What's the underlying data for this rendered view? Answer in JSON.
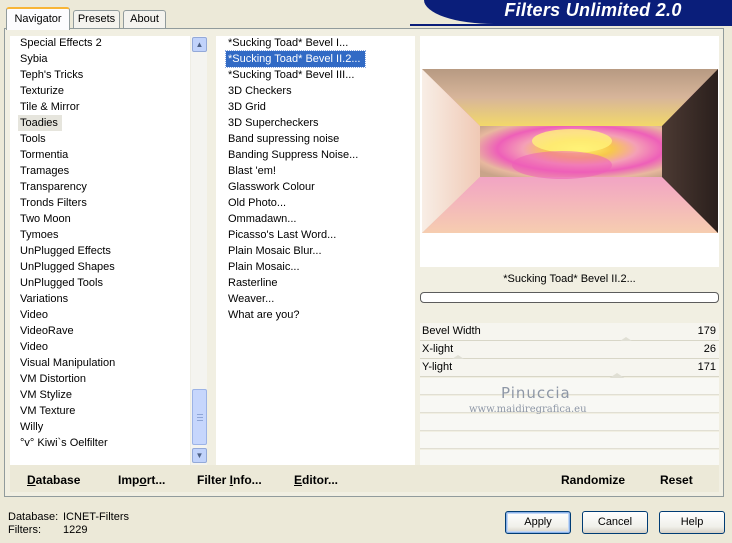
{
  "tabs": [
    "Navigator",
    "Presets",
    "About"
  ],
  "active_tab": "Navigator",
  "app_title": "Filters Unlimited 2.0",
  "categories": [
    "Special Effects 2",
    "Sybia",
    "Teph's Tricks",
    "Texturize",
    "Tile & Mirror",
    "Toadies",
    "Tools",
    "Tormentia",
    "Tramages",
    "Transparency",
    "Tronds Filters",
    "Two Moon",
    "Tymoes",
    "UnPlugged Effects",
    "UnPlugged Shapes",
    "UnPlugged Tools",
    "Variations",
    "Video",
    "VideoRave",
    "Video",
    "Visual Manipulation",
    "VM Distortion",
    "VM Stylize",
    "VM Texture",
    "Willy",
    "°v° Kiwi`s Oelfilter"
  ],
  "selected_category": "Toadies",
  "filters": [
    "*Sucking Toad*  Bevel I...",
    "*Sucking Toad*  Bevel II.2...",
    "*Sucking Toad*  Bevel III...",
    "3D Checkers",
    "3D Grid",
    "3D Supercheckers",
    "Band supressing noise",
    "Banding Suppress Noise...",
    "Blast 'em!",
    "Glasswork Colour",
    "Old Photo...",
    "Ommadawn...",
    "Picasso's Last Word...",
    "Plain Mosaic Blur...",
    "Plain Mosaic...",
    "Rasterline",
    "Weaver...",
    "What are you?"
  ],
  "selected_filter": "*Sucking Toad*  Bevel II.2...",
  "current_filter_name": "*Sucking Toad*  Bevel II.2...",
  "progress": 0,
  "params": [
    {
      "name": "Bevel Width",
      "value": "179",
      "level": 179
    },
    {
      "name": "X-light",
      "value": "26",
      "level": 26
    },
    {
      "name": "Y-light",
      "value": "171",
      "level": 171
    }
  ],
  "watermark": {
    "line1": "Pinuccia",
    "line2": "www.maidiregrafica.eu"
  },
  "left_buttons": {
    "database": {
      "underline": "D",
      "rest": "atabase"
    },
    "import": {
      "pre": "Imp",
      "underline": "o",
      "rest": "rt..."
    },
    "filter_info": {
      "pre": "Filter ",
      "underline": "I",
      "rest": "nfo..."
    },
    "editor": {
      "underline": "E",
      "rest": "ditor..."
    }
  },
  "right_buttons": {
    "randomize": "Randomize",
    "reset": "Reset"
  },
  "status": {
    "database_label": "Database:",
    "database_value": "ICNET-Filters",
    "filters_label": "Filters:",
    "filters_value": "1229"
  },
  "dialog_buttons": {
    "apply": "Apply",
    "cancel": "Cancel",
    "help": "Help"
  },
  "colors": {
    "selection": "#316ac5",
    "title_banner": "#0a1e7a"
  },
  "icons": {
    "scroll_up": "triangle-up",
    "scroll_down": "triangle-down"
  }
}
